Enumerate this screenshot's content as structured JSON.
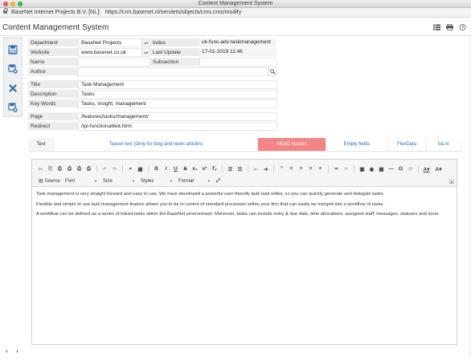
{
  "window": {
    "title": "Content Management System"
  },
  "urlbar": {
    "site": "BaseNet Internet Projects B.V. [NL]",
    "url": "https://crm.basenet.nl/servlets/objects/cms.cms/modify"
  },
  "header": {
    "title": "Content Management System",
    "icons": [
      "list-icon",
      "print-icon",
      "help-icon"
    ]
  },
  "form": {
    "department": {
      "label": "Department",
      "value": "BaseNet Projects"
    },
    "index": {
      "label": "Index",
      "value": "uk-func-adv-taskmanagement"
    },
    "website": {
      "label": "Website",
      "value": "www.basenet.co.uk"
    },
    "last_update": {
      "label": "Last Update",
      "value": "17-01-2019 11:46"
    },
    "name": {
      "label": "Name",
      "value": ""
    },
    "subsection": {
      "label": "Subsection",
      "value": ""
    },
    "author": {
      "label": "Author",
      "value": ""
    },
    "title": {
      "label": "Title",
      "value": "Task Management"
    },
    "description": {
      "label": "Description",
      "value": "Tasks"
    },
    "keywords": {
      "label": "Key Words",
      "value": "Tasks, insight, management"
    },
    "page": {
      "label": "Page",
      "value": "/features/tasks/management/"
    },
    "redirect": {
      "label": "Redirect",
      "value": "/tpl-functionaliteit.html"
    }
  },
  "tabs": [
    {
      "label": "Text"
    },
    {
      "label": "Teaser text (Only for blog and news articles)"
    },
    {
      "label": "HEAD section"
    },
    {
      "label": "Empty fields"
    },
    {
      "label": "FlexData"
    },
    {
      "label": "ba.nl"
    }
  ],
  "toolbar": {
    "source_label": "Source",
    "font_label": "Font",
    "size_label": "Size",
    "styles_label": "Styles",
    "format_label": "Format"
  },
  "editor": {
    "paragraphs": [
      "Task management is very straight forward and easy to use. We have developed a powerful user-friendly bulk task editor, so you can quickly generate and delegate tasks.",
      "Flexible and simple to use task management feature allows you to be in control of standard processes within your firm that can easily be merged into a workflow of tasks.",
      "A workflow can be defined as a series of linked tasks within the BaseNet environment. Moreover, tasks can include entry & due date, time allocations, assigned staff, messages, statuses and more."
    ]
  },
  "colors": {
    "accent": "#2a6db5",
    "head_tab": "#f38585"
  }
}
